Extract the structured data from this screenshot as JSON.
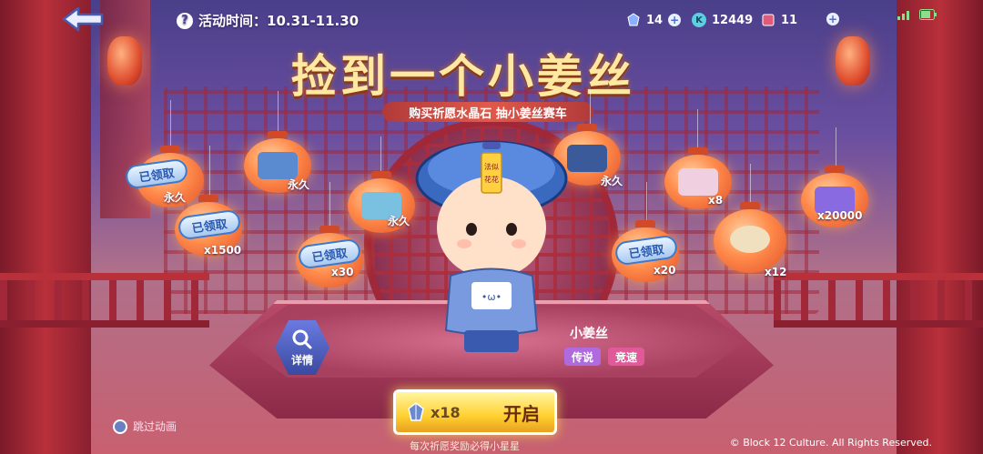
{
  "header": {
    "back_icon": "back-arrow-icon",
    "help_icon_glyph": "?",
    "event_time_label": "活动时间：10.31-11.30",
    "currency_crystal": "14",
    "currency_coin": "12449",
    "currency_ticket": "11",
    "coin_glyph": "K"
  },
  "title": {
    "main": "捡到一个小姜丝",
    "subtitle": "购买祈愿水晶石 抽小姜丝赛车"
  },
  "rewards": [
    {
      "label": "永久",
      "claimed": true
    },
    {
      "label": "x1500",
      "claimed": true
    },
    {
      "label": "永久",
      "claimed": false
    },
    {
      "label": "x30",
      "claimed": true
    },
    {
      "label": "永久",
      "claimed": false
    },
    {
      "label": "永久",
      "claimed": false
    },
    {
      "label": "x8",
      "claimed": false
    },
    {
      "label": "x20",
      "claimed": true
    },
    {
      "label": "x20000",
      "claimed": false
    },
    {
      "label": "x12",
      "claimed": false
    }
  ],
  "claimed_text": "已领取",
  "character": {
    "name": "小姜丝",
    "tag_rarity": "传说",
    "tag_type": "竞速",
    "hat_text": "法似花花"
  },
  "details_label": "详情",
  "open_button": {
    "cost": "x18",
    "label": "开启"
  },
  "bottom_note": "每次祈愿奖励必得小星星",
  "skip_label": "跳过动画",
  "copyright": "© Block 12 Culture. All Rights Reserved.",
  "colors": {
    "accent_gold": "#ffd030",
    "pillar_red": "#b8303a",
    "claimed_blue": "#3a7ad0",
    "tag_legend": "#b06ae0",
    "tag_race": "#e05a9a"
  }
}
